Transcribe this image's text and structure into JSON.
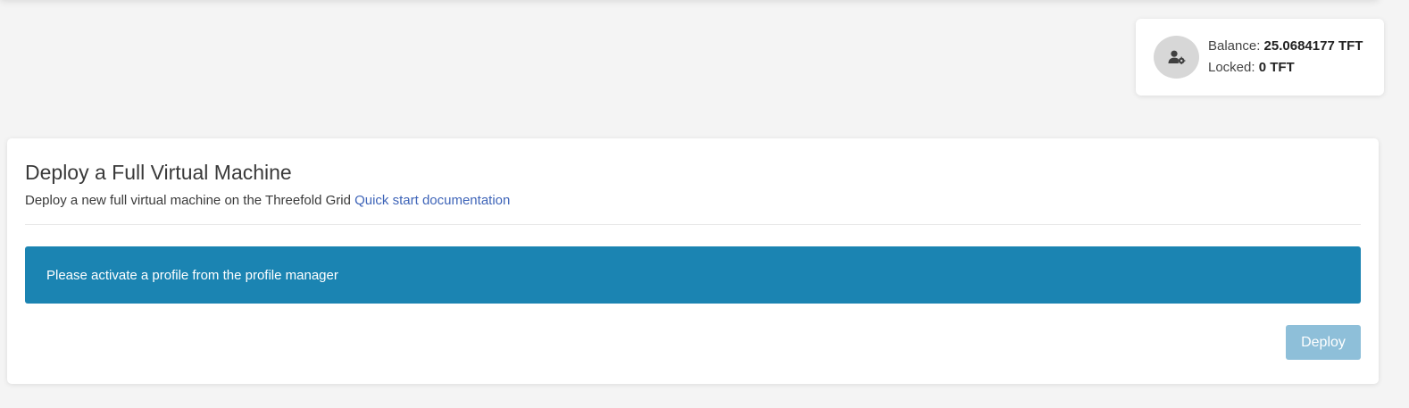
{
  "profile": {
    "balance_label": "Balance:",
    "balance_value": "25.0684177 TFT",
    "locked_label": "Locked:",
    "locked_value": "0 TFT",
    "avatar_icon": "user-gear-icon"
  },
  "main": {
    "title": "Deploy a Full Virtual Machine",
    "subtitle": "Deploy a new full virtual machine on the Threefold Grid",
    "doc_link": "Quick start documentation",
    "alert": "Please activate a profile from the profile manager",
    "deploy_label": "Deploy"
  },
  "colors": {
    "alert_bg": "#1b84b2",
    "link": "#3e64b8",
    "deploy_disabled": "#8ebfd9",
    "page_bg": "#f4f4f4"
  }
}
